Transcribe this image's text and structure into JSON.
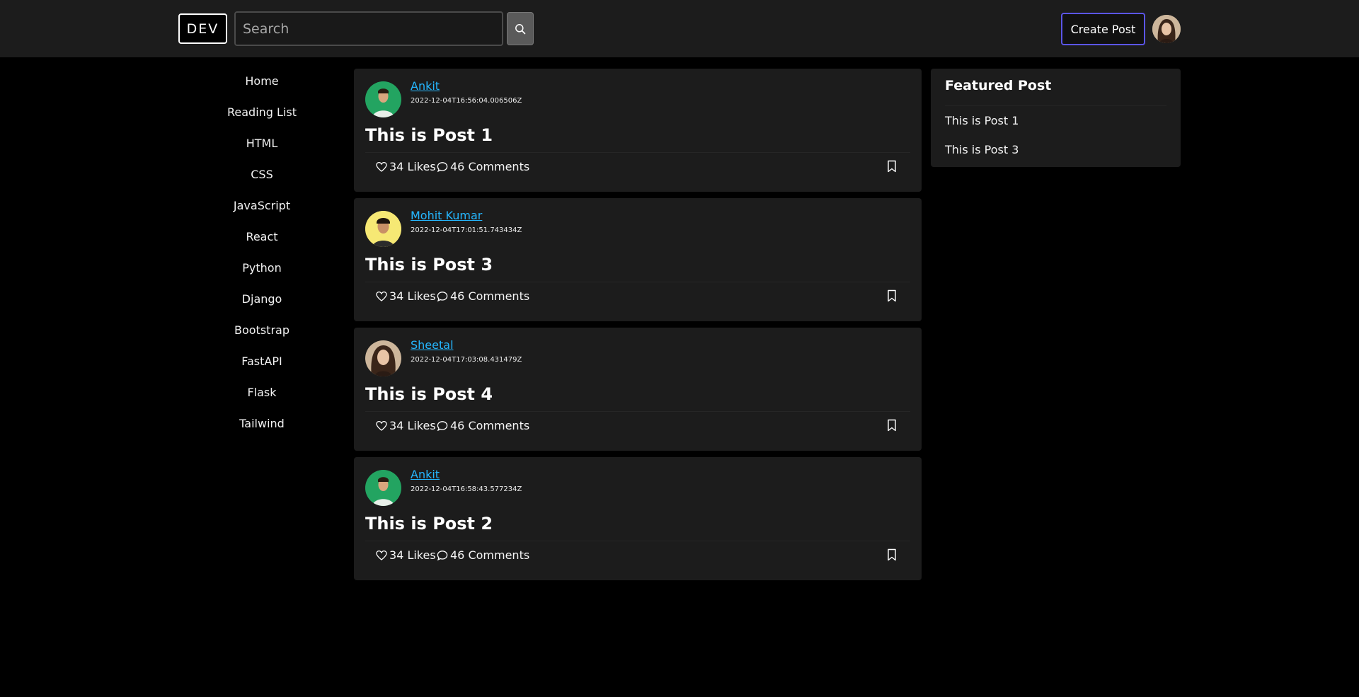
{
  "header": {
    "logo": "DEV",
    "search_placeholder": "Search",
    "create_label": "Create Post"
  },
  "sidebar": {
    "items": [
      {
        "label": "Home"
      },
      {
        "label": "Reading List"
      },
      {
        "label": "HTML"
      },
      {
        "label": "CSS"
      },
      {
        "label": "JavaScript"
      },
      {
        "label": "React"
      },
      {
        "label": "Python"
      },
      {
        "label": "Django"
      },
      {
        "label": "Bootstrap"
      },
      {
        "label": "FastAPI"
      },
      {
        "label": "Flask"
      },
      {
        "label": "Tailwind"
      }
    ]
  },
  "posts": [
    {
      "author": "Ankit",
      "date": "2022-12-04T16:56:04.006506Z",
      "title": "This is Post 1",
      "likes": "34 Likes",
      "comments": "46 Comments"
    },
    {
      "author": "Mohit Kumar",
      "date": "2022-12-04T17:01:51.743434Z",
      "title": "This is Post 3",
      "likes": "34 Likes",
      "comments": "46 Comments"
    },
    {
      "author": "Sheetal",
      "date": "2022-12-04T17:03:08.431479Z",
      "title": "This is Post 4",
      "likes": "34 Likes",
      "comments": "46 Comments"
    },
    {
      "author": "Ankit",
      "date": "2022-12-04T16:58:43.577234Z",
      "title": "This is Post 2",
      "likes": "34 Likes",
      "comments": "46 Comments"
    }
  ],
  "featured": {
    "title": "Featured Post",
    "links": [
      {
        "label": "This is Post 1"
      },
      {
        "label": "This is Post 3"
      }
    ]
  },
  "colors": {
    "background": "#000000",
    "surface": "#1c1c1c",
    "author_link": "#25b7ff",
    "create_border": "#5b55e6"
  },
  "icons": {
    "search": "search-icon",
    "like": "heart-icon",
    "comment": "comment-icon",
    "bookmark": "bookmark-icon"
  }
}
